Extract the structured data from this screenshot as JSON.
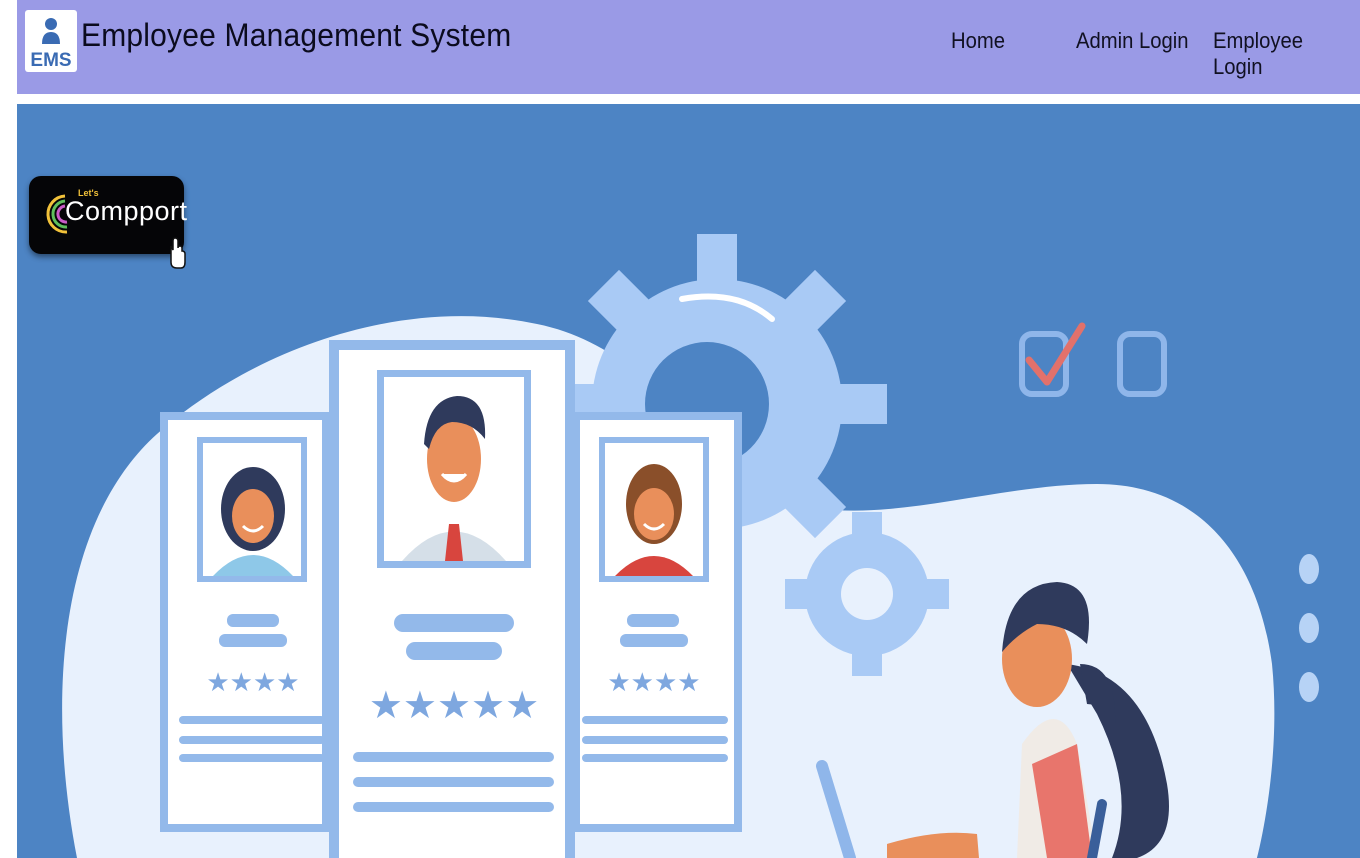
{
  "header": {
    "title": "Employee Management System",
    "logo_text": "EMS"
  },
  "nav": {
    "items": [
      {
        "label": "Home"
      },
      {
        "label": "Admin Login"
      },
      {
        "label": "Employee Login"
      }
    ]
  },
  "badge": {
    "small_text": "Let's",
    "text": "Compport"
  },
  "colors": {
    "navbar": "#9a9ae6",
    "hero_background": "#4d84c4",
    "card_accent": "#93b9ea"
  }
}
